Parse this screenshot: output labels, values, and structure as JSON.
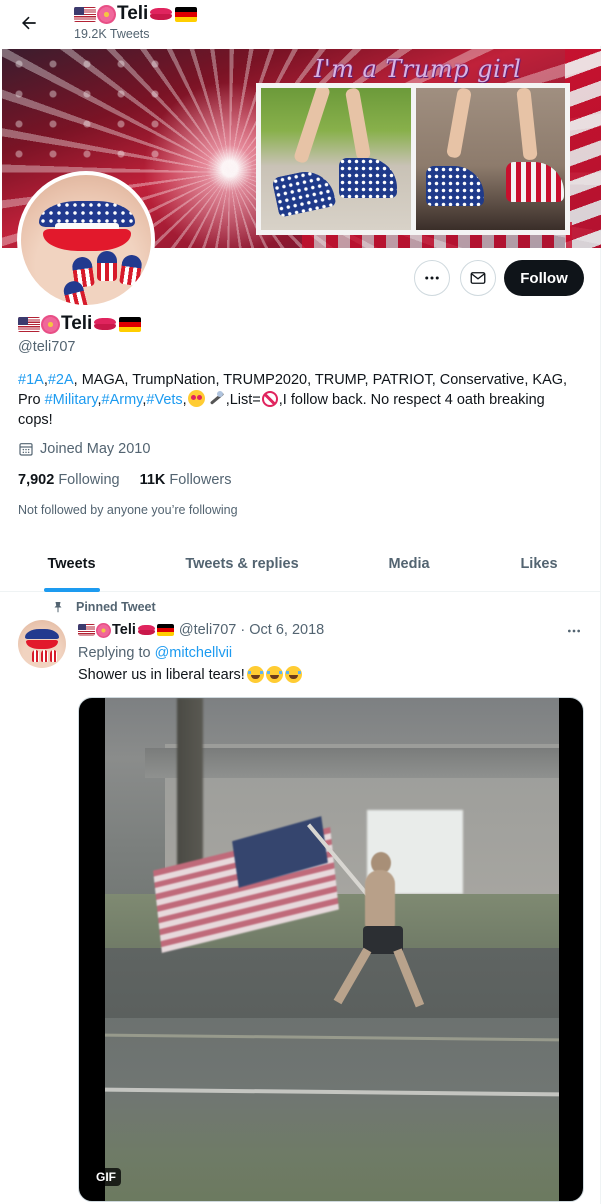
{
  "header": {
    "back_label": "Back",
    "name": "Teli",
    "tweet_count": "19.2K Tweets"
  },
  "banner": {
    "title": "I'm a Trump girl"
  },
  "actions": {
    "more_icon": "more-icon",
    "message_icon": "envelope-icon",
    "follow_label": "Follow",
    "accent": "#1d9bf0",
    "follow_bg": "#0f1419"
  },
  "profile": {
    "name": "Teli",
    "handle": "@teli707",
    "bio": {
      "tag1": "#1A",
      "sep1": ",",
      "tag2": "#2A",
      "text1": ", MAGA, TrumpNation, TRUMP2020, TRUMP, PATRIOT, Conservative, KAG, Pro ",
      "tag3": "#Military",
      "sep2": ",",
      "tag4": "#Army",
      "sep3": ",",
      "tag5": "#Vets",
      "sep4": ",",
      "text2": ",List=",
      "text3": ",I follow back. No respect 4 oath breaking cops!"
    },
    "joined": "Joined May 2010",
    "following_count": "7,902",
    "following_label": "Following",
    "followers_count": "11K",
    "followers_label": "Followers",
    "not_followed": "Not followed by anyone you’re following"
  },
  "tabs": [
    {
      "label": "Tweets",
      "active": true
    },
    {
      "label": "Tweets & replies",
      "active": false
    },
    {
      "label": "Media",
      "active": false
    },
    {
      "label": "Likes",
      "active": false
    }
  ],
  "tweet": {
    "pinned_label": "Pinned Tweet",
    "author_name": "Teli",
    "meta": "@teli707 · Oct 6, 2018",
    "replying_prefix": "Replying to ",
    "replying_to": "@mitchellvii",
    "text": "Shower us in liberal tears!",
    "media_badge": "GIF"
  }
}
